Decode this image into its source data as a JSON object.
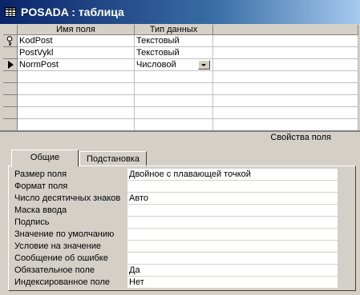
{
  "window": {
    "title": "POSADA : таблица"
  },
  "grid": {
    "headers": {
      "field_name": "Имя поля",
      "data_type": "Тип данных",
      "description": ""
    },
    "rows": [
      {
        "name": "KodPost",
        "type": "Текстовый"
      },
      {
        "name": "PostVykl",
        "type": "Текстовый"
      },
      {
        "name": "NormPost",
        "type": "Числовой"
      }
    ],
    "current_row": 2
  },
  "properties": {
    "section_label": "Свойства поля",
    "tabs": [
      {
        "label": "Общие",
        "active": true
      },
      {
        "label": "Подстановка",
        "active": false
      }
    ],
    "rows": [
      {
        "label": "Размер поля",
        "value": "Двойное с плавающей точкой"
      },
      {
        "label": "Формат поля",
        "value": ""
      },
      {
        "label": "Число десятичных знаков",
        "value": "Авто"
      },
      {
        "label": "Маска ввода",
        "value": ""
      },
      {
        "label": "Подпись",
        "value": ""
      },
      {
        "label": "Значение по умолчанию",
        "value": ""
      },
      {
        "label": "Условие на значение",
        "value": ""
      },
      {
        "label": "Сообщение об ошибке",
        "value": ""
      },
      {
        "label": "Обязательное поле",
        "value": "Да"
      },
      {
        "label": "Индексированное поле",
        "value": "Нет"
      }
    ]
  },
  "icons": {
    "title": "table-icon",
    "key": "primary-key-icon",
    "current_row": "current-row-arrow-icon",
    "combo": "dropdown-arrow-icon"
  },
  "colors": {
    "titlebar_start": "#0a246a",
    "titlebar_end": "#a6caf0",
    "face": "#d4d0c8"
  }
}
